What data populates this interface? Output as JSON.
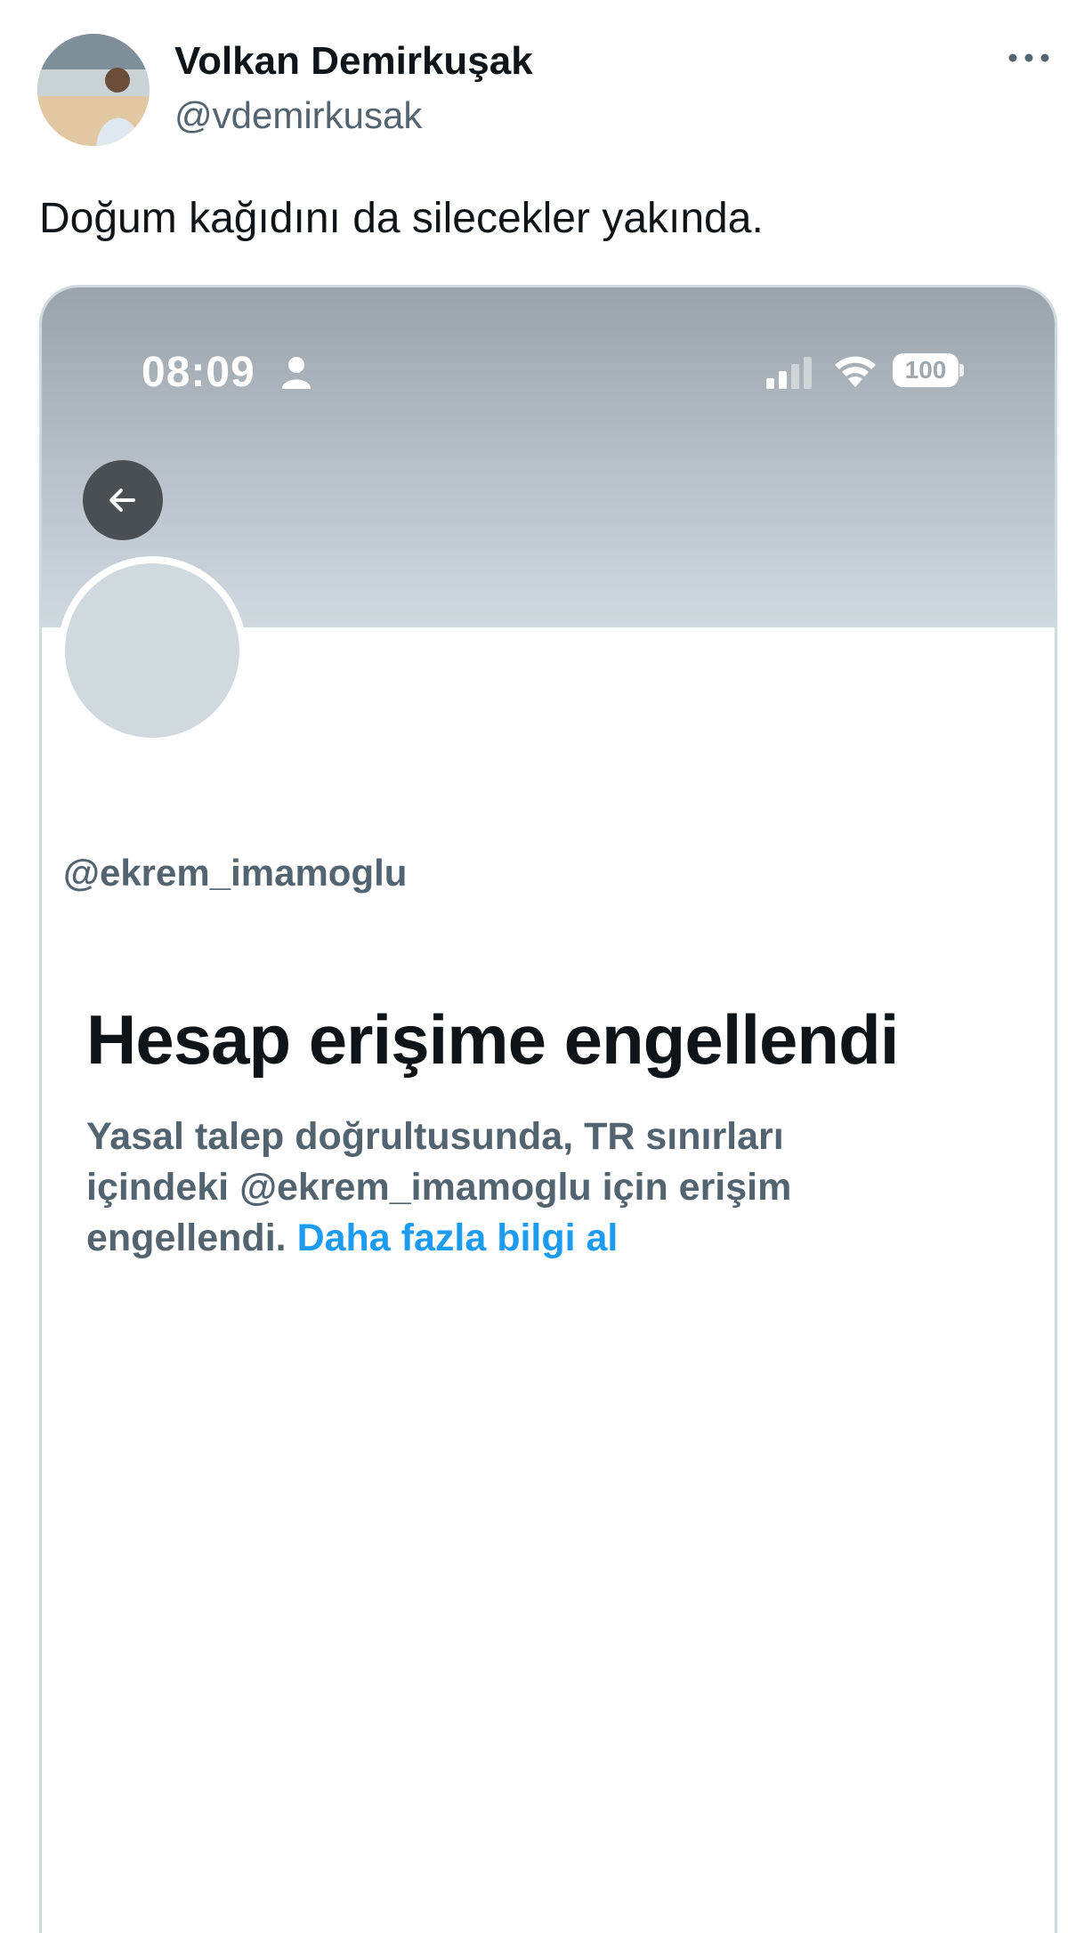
{
  "author": {
    "name": "Volkan Demirkuşak",
    "handle": "@vdemirkusak"
  },
  "tweet": {
    "text": "Doğum kağıdını da silecekler yakında."
  },
  "embedded_screenshot": {
    "status_bar": {
      "time": "08:09",
      "battery": "100"
    },
    "profile": {
      "handle": "@ekrem_imamoglu"
    },
    "notice": {
      "title": "Hesap erişime engellendi",
      "line1": "Yasal talep doğrultusunda, TR sınırları",
      "line2": "içindeki @ekrem_imamoglu için erişim",
      "line3_prefix": "engellendi.",
      "link": "Daha fazla bilgi al"
    }
  },
  "icons": {
    "more": "more-icon",
    "back": "arrow-left-icon",
    "person": "person-icon",
    "signal": "signal-icon",
    "wifi": "wifi-icon"
  }
}
